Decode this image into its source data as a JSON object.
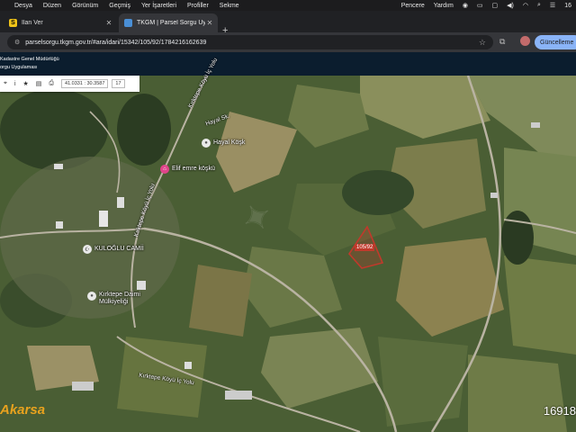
{
  "menubar": {
    "items": [
      "Desya",
      "Düzen",
      "Görünüm",
      "Geçmiş",
      "Yer İşaretleri",
      "Profiller",
      "Sekme"
    ],
    "right_items": [
      "Pencere",
      "Yardım"
    ],
    "clock_partial": "16"
  },
  "tabs": [
    {
      "label": "İlan Ver",
      "favicon_color": "#f0c419",
      "favicon_letter": "S",
      "active": false
    },
    {
      "label": "TKGM | Parsel Sorgu Uygulam",
      "favicon_color": "#4a8fd6",
      "active": true
    }
  ],
  "address_bar": {
    "url": "parselsorgu.tkgm.gov.tr/#ara/idari/15342/105/92/1784216162639"
  },
  "update_button": "Güncelleme",
  "app_header": {
    "line1": "Kadastre Genel Müdürlüğü",
    "line2": "orgu Uygulaması"
  },
  "map_toolbar": {
    "coords": "41.0331 : 30.3587",
    "zoom": "17"
  },
  "poi": {
    "hayal_kosk": "Hayal Köşk",
    "elif_emre": "Elif emre köşkü",
    "kuloglu_camii": "KULOĞLU CAMİİ",
    "kirktepe_masjid_l1": "Kırktepe Daimi",
    "kirktepe_masjid_l2": "Mülkiyeliği"
  },
  "roads": {
    "kirktepe_ic_yolu_top": "Kırktepe Köyü İç Yolu",
    "hayal_sk": "Hayal Sk.",
    "kirktepe_ic_yolu_left": "Kırktepe Köyü İç Yolu",
    "kirktepe_ic_yolu_bottom": "Kırktepe Köyü İç Yolu"
  },
  "parcel_label": "105/92",
  "watermark": "Akarsa",
  "corner_id": "16918",
  "colors": {
    "parcel_outline": "#c0392b",
    "pin_pink": "#e0448a",
    "pin_gray": "#e9e9e9"
  }
}
